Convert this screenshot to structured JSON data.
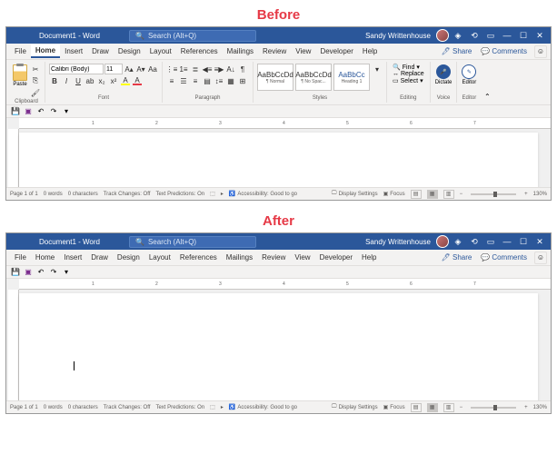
{
  "labels": {
    "before": "Before",
    "after": "After"
  },
  "titlebar": {
    "doc_title": "Document1 - Word",
    "search_placeholder": "Search (Alt+Q)",
    "username": "Sandy Writtenhouse"
  },
  "menu": {
    "items": [
      "File",
      "Home",
      "Insert",
      "Draw",
      "Design",
      "Layout",
      "References",
      "Mailings",
      "Review",
      "View",
      "Developer",
      "Help"
    ],
    "share": "Share",
    "comments": "Comments"
  },
  "ribbon": {
    "clipboard": {
      "label": "Clipboard",
      "paste": "Paste"
    },
    "font": {
      "label": "Font",
      "name": "Calibri (Body)",
      "size": "11"
    },
    "paragraph": {
      "label": "Paragraph"
    },
    "styles": {
      "label": "Styles",
      "items": [
        {
          "preview": "AaBbCcDd",
          "name": "¶ Normal"
        },
        {
          "preview": "AaBbCcDd",
          "name": "¶ No Spac..."
        },
        {
          "preview": "AaBbCc",
          "name": "Heading 1"
        }
      ]
    },
    "editing": {
      "label": "Editing",
      "find": "Find",
      "replace": "Replace",
      "select": "Select"
    },
    "voice": {
      "label": "Voice",
      "dictate": "Dictate"
    },
    "editor": {
      "label": "Editor",
      "btn": "Editor"
    }
  },
  "ruler": {
    "marks": [
      "1",
      "2",
      "3",
      "4",
      "5",
      "6",
      "7"
    ]
  },
  "statusbar": {
    "page": "Page 1 of 1",
    "words": "0 words",
    "chars": "0 characters",
    "track": "Track Changes: Off",
    "predict": "Text Predictions: On",
    "accessibility": "Accessibility: Good to go",
    "display": "Display Settings",
    "focus": "Focus",
    "zoom": "130%"
  }
}
